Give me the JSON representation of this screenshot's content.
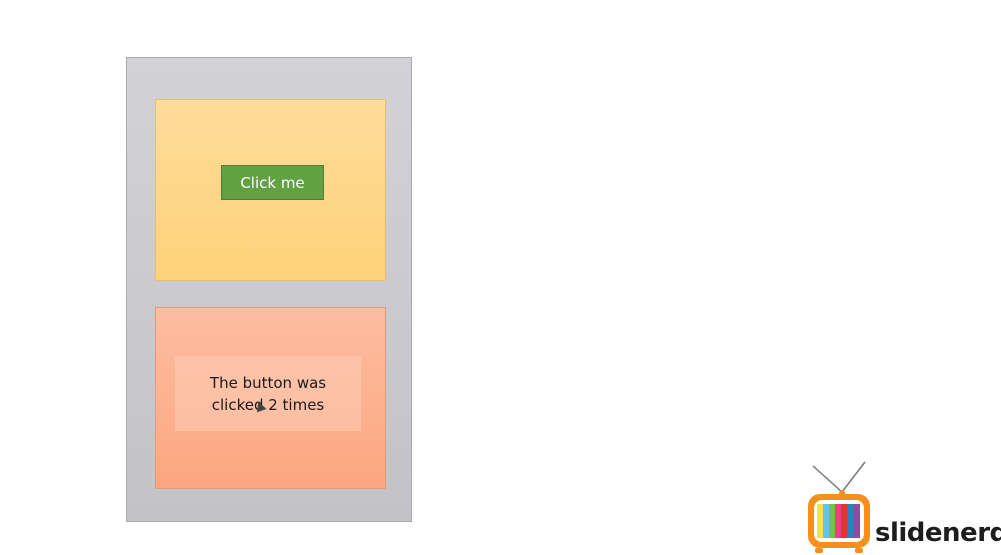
{
  "top_panel": {
    "button_label": "Click me"
  },
  "bottom_panel": {
    "result_text": "The button was clicked 2 times"
  },
  "logo": {
    "brand_name": "slidenerd",
    "icon": "tv-icon"
  },
  "colors": {
    "frame": "#c9c8cc",
    "top_panel": "#ffd889",
    "bottom_panel": "#fcb391",
    "button": "#62a044",
    "button_text": "#ffffff",
    "logo_orange": "#f5901e"
  }
}
